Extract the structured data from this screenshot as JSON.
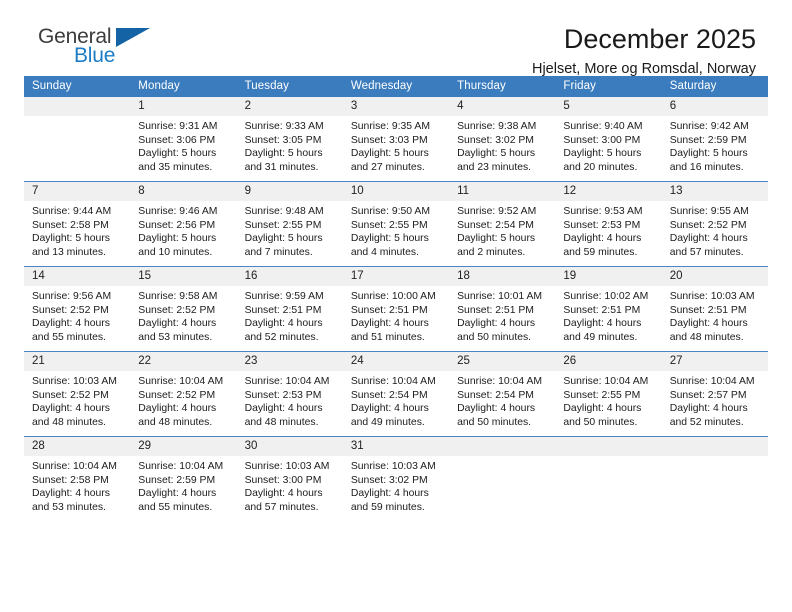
{
  "branding": {
    "logo_general": "General",
    "logo_blue": "Blue",
    "logo_triangle_color": "#1464a5",
    "logo_blue_color": "#1d7dc4"
  },
  "header": {
    "title": "December 2025",
    "subtitle": "Hjelset, More og Romsdal, Norway"
  },
  "theme": {
    "header_background": "#3b7cbe",
    "header_text": "#ffffff",
    "daynum_background": "#f0f0f0",
    "row_border": "#4a86c5"
  },
  "weekday_headers": [
    "Sunday",
    "Monday",
    "Tuesday",
    "Wednesday",
    "Thursday",
    "Friday",
    "Saturday"
  ],
  "weeks": [
    [
      {
        "day": "",
        "sunrise": "",
        "sunset": "",
        "daylight_line1": "",
        "daylight_line2": ""
      },
      {
        "day": "1",
        "sunrise": "Sunrise: 9:31 AM",
        "sunset": "Sunset: 3:06 PM",
        "daylight_line1": "Daylight: 5 hours",
        "daylight_line2": "and 35 minutes."
      },
      {
        "day": "2",
        "sunrise": "Sunrise: 9:33 AM",
        "sunset": "Sunset: 3:05 PM",
        "daylight_line1": "Daylight: 5 hours",
        "daylight_line2": "and 31 minutes."
      },
      {
        "day": "3",
        "sunrise": "Sunrise: 9:35 AM",
        "sunset": "Sunset: 3:03 PM",
        "daylight_line1": "Daylight: 5 hours",
        "daylight_line2": "and 27 minutes."
      },
      {
        "day": "4",
        "sunrise": "Sunrise: 9:38 AM",
        "sunset": "Sunset: 3:02 PM",
        "daylight_line1": "Daylight: 5 hours",
        "daylight_line2": "and 23 minutes."
      },
      {
        "day": "5",
        "sunrise": "Sunrise: 9:40 AM",
        "sunset": "Sunset: 3:00 PM",
        "daylight_line1": "Daylight: 5 hours",
        "daylight_line2": "and 20 minutes."
      },
      {
        "day": "6",
        "sunrise": "Sunrise: 9:42 AM",
        "sunset": "Sunset: 2:59 PM",
        "daylight_line1": "Daylight: 5 hours",
        "daylight_line2": "and 16 minutes."
      }
    ],
    [
      {
        "day": "7",
        "sunrise": "Sunrise: 9:44 AM",
        "sunset": "Sunset: 2:58 PM",
        "daylight_line1": "Daylight: 5 hours",
        "daylight_line2": "and 13 minutes."
      },
      {
        "day": "8",
        "sunrise": "Sunrise: 9:46 AM",
        "sunset": "Sunset: 2:56 PM",
        "daylight_line1": "Daylight: 5 hours",
        "daylight_line2": "and 10 minutes."
      },
      {
        "day": "9",
        "sunrise": "Sunrise: 9:48 AM",
        "sunset": "Sunset: 2:55 PM",
        "daylight_line1": "Daylight: 5 hours",
        "daylight_line2": "and 7 minutes."
      },
      {
        "day": "10",
        "sunrise": "Sunrise: 9:50 AM",
        "sunset": "Sunset: 2:55 PM",
        "daylight_line1": "Daylight: 5 hours",
        "daylight_line2": "and 4 minutes."
      },
      {
        "day": "11",
        "sunrise": "Sunrise: 9:52 AM",
        "sunset": "Sunset: 2:54 PM",
        "daylight_line1": "Daylight: 5 hours",
        "daylight_line2": "and 2 minutes."
      },
      {
        "day": "12",
        "sunrise": "Sunrise: 9:53 AM",
        "sunset": "Sunset: 2:53 PM",
        "daylight_line1": "Daylight: 4 hours",
        "daylight_line2": "and 59 minutes."
      },
      {
        "day": "13",
        "sunrise": "Sunrise: 9:55 AM",
        "sunset": "Sunset: 2:52 PM",
        "daylight_line1": "Daylight: 4 hours",
        "daylight_line2": "and 57 minutes."
      }
    ],
    [
      {
        "day": "14",
        "sunrise": "Sunrise: 9:56 AM",
        "sunset": "Sunset: 2:52 PM",
        "daylight_line1": "Daylight: 4 hours",
        "daylight_line2": "and 55 minutes."
      },
      {
        "day": "15",
        "sunrise": "Sunrise: 9:58 AM",
        "sunset": "Sunset: 2:52 PM",
        "daylight_line1": "Daylight: 4 hours",
        "daylight_line2": "and 53 minutes."
      },
      {
        "day": "16",
        "sunrise": "Sunrise: 9:59 AM",
        "sunset": "Sunset: 2:51 PM",
        "daylight_line1": "Daylight: 4 hours",
        "daylight_line2": "and 52 minutes."
      },
      {
        "day": "17",
        "sunrise": "Sunrise: 10:00 AM",
        "sunset": "Sunset: 2:51 PM",
        "daylight_line1": "Daylight: 4 hours",
        "daylight_line2": "and 51 minutes."
      },
      {
        "day": "18",
        "sunrise": "Sunrise: 10:01 AM",
        "sunset": "Sunset: 2:51 PM",
        "daylight_line1": "Daylight: 4 hours",
        "daylight_line2": "and 50 minutes."
      },
      {
        "day": "19",
        "sunrise": "Sunrise: 10:02 AM",
        "sunset": "Sunset: 2:51 PM",
        "daylight_line1": "Daylight: 4 hours",
        "daylight_line2": "and 49 minutes."
      },
      {
        "day": "20",
        "sunrise": "Sunrise: 10:03 AM",
        "sunset": "Sunset: 2:51 PM",
        "daylight_line1": "Daylight: 4 hours",
        "daylight_line2": "and 48 minutes."
      }
    ],
    [
      {
        "day": "21",
        "sunrise": "Sunrise: 10:03 AM",
        "sunset": "Sunset: 2:52 PM",
        "daylight_line1": "Daylight: 4 hours",
        "daylight_line2": "and 48 minutes."
      },
      {
        "day": "22",
        "sunrise": "Sunrise: 10:04 AM",
        "sunset": "Sunset: 2:52 PM",
        "daylight_line1": "Daylight: 4 hours",
        "daylight_line2": "and 48 minutes."
      },
      {
        "day": "23",
        "sunrise": "Sunrise: 10:04 AM",
        "sunset": "Sunset: 2:53 PM",
        "daylight_line1": "Daylight: 4 hours",
        "daylight_line2": "and 48 minutes."
      },
      {
        "day": "24",
        "sunrise": "Sunrise: 10:04 AM",
        "sunset": "Sunset: 2:54 PM",
        "daylight_line1": "Daylight: 4 hours",
        "daylight_line2": "and 49 minutes."
      },
      {
        "day": "25",
        "sunrise": "Sunrise: 10:04 AM",
        "sunset": "Sunset: 2:54 PM",
        "daylight_line1": "Daylight: 4 hours",
        "daylight_line2": "and 50 minutes."
      },
      {
        "day": "26",
        "sunrise": "Sunrise: 10:04 AM",
        "sunset": "Sunset: 2:55 PM",
        "daylight_line1": "Daylight: 4 hours",
        "daylight_line2": "and 50 minutes."
      },
      {
        "day": "27",
        "sunrise": "Sunrise: 10:04 AM",
        "sunset": "Sunset: 2:57 PM",
        "daylight_line1": "Daylight: 4 hours",
        "daylight_line2": "and 52 minutes."
      }
    ],
    [
      {
        "day": "28",
        "sunrise": "Sunrise: 10:04 AM",
        "sunset": "Sunset: 2:58 PM",
        "daylight_line1": "Daylight: 4 hours",
        "daylight_line2": "and 53 minutes."
      },
      {
        "day": "29",
        "sunrise": "Sunrise: 10:04 AM",
        "sunset": "Sunset: 2:59 PM",
        "daylight_line1": "Daylight: 4 hours",
        "daylight_line2": "and 55 minutes."
      },
      {
        "day": "30",
        "sunrise": "Sunrise: 10:03 AM",
        "sunset": "Sunset: 3:00 PM",
        "daylight_line1": "Daylight: 4 hours",
        "daylight_line2": "and 57 minutes."
      },
      {
        "day": "31",
        "sunrise": "Sunrise: 10:03 AM",
        "sunset": "Sunset: 3:02 PM",
        "daylight_line1": "Daylight: 4 hours",
        "daylight_line2": "and 59 minutes."
      },
      {
        "day": "",
        "sunrise": "",
        "sunset": "",
        "daylight_line1": "",
        "daylight_line2": ""
      },
      {
        "day": "",
        "sunrise": "",
        "sunset": "",
        "daylight_line1": "",
        "daylight_line2": ""
      },
      {
        "day": "",
        "sunrise": "",
        "sunset": "",
        "daylight_line1": "",
        "daylight_line2": ""
      }
    ]
  ]
}
